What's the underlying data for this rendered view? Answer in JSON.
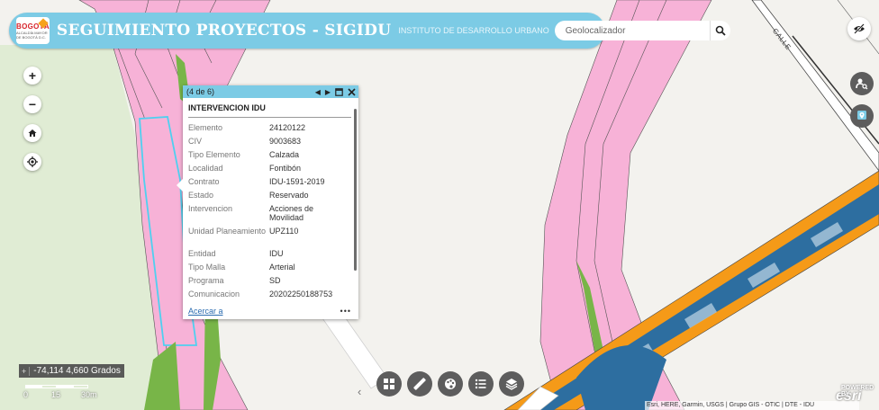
{
  "header": {
    "logo_text": "BOGOTÁ",
    "logo_sub": "ALCALDÍA MAYOR DE BOGOTÁ D.C.",
    "title": "SEGUIMIENTO PROYECTOS - SIGIDU",
    "subtitle": "INSTITUTO DE DESARROLLO URBANO",
    "search_placeholder": "Geolocalizador",
    "accent_color": "#7ccbe5"
  },
  "map_controls": {
    "zoom_in": "+",
    "zoom_out": "−",
    "icons": [
      "plus-icon",
      "minus-icon",
      "home-icon",
      "locate-icon"
    ]
  },
  "right_controls": {
    "icons": [
      "visibility-off-icon",
      "person-search-icon",
      "location-pin-icon"
    ]
  },
  "popup": {
    "counter": "(4 de 6)",
    "title": "INTERVENCION IDU",
    "fields": [
      {
        "key": "Elemento",
        "value": "24120122"
      },
      {
        "key": "CIV",
        "value": "9003683"
      },
      {
        "key": "Tipo Elemento",
        "value": "Calzada"
      },
      {
        "key": "Localidad",
        "value": "Fontibón"
      },
      {
        "key": "Contrato",
        "value": "IDU-1591-2019"
      },
      {
        "key": "Estado",
        "value": "Reservado"
      },
      {
        "key": "Intervencion",
        "value": "Acciones de Movilidad"
      },
      {
        "key": "Unidad Planeamiento",
        "value": "UPZ110"
      },
      {
        "key": "Entidad",
        "value": "IDU"
      },
      {
        "key": "Tipo Malla",
        "value": "Arterial"
      },
      {
        "key": "Programa",
        "value": "SD"
      },
      {
        "key": "Comunicacion",
        "value": "20202250188753"
      }
    ],
    "zoom_link": "Acercar a",
    "more": "•••"
  },
  "coordinates": {
    "text": "-74,114 4,660 Grados"
  },
  "scalebar": {
    "labels": [
      "0",
      "15",
      "30m"
    ]
  },
  "toolbar": {
    "icons": [
      "grid-icon",
      "measure-icon",
      "palette-icon",
      "list-icon",
      "layers-icon"
    ]
  },
  "street_label": "CALLE",
  "attribution": "Esri, HERE, Garmin, USGS | Grupo GIS - OTIC | DTE - IDU",
  "esri_logo": "esri",
  "esri_power": "POWERED BY"
}
